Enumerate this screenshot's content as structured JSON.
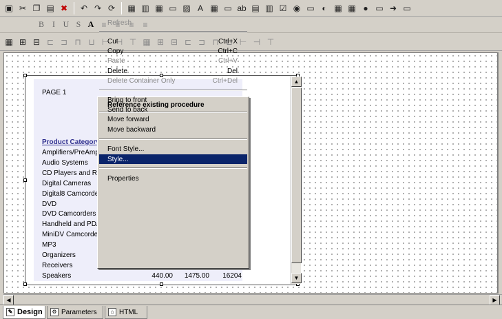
{
  "toolbar_icons": {
    "row1": [
      "save-icon",
      "cut-icon",
      "copy-icon",
      "paste-icon",
      "delete-icon",
      "undo-icon",
      "redo-icon",
      "refresh-icon",
      "form-icon",
      "chart-icon",
      "table-icon",
      "rectangle-icon",
      "image-icon",
      "text-icon",
      "grid-icon",
      "label-icon",
      "textbox-icon",
      "listbox-icon",
      "combo-icon",
      "checkbox-icon",
      "radio-icon",
      "button-icon",
      "palette-icon",
      "calendar-icon",
      "crosstab-icon",
      "color-icon",
      "window-icon",
      "arrow-icon",
      "border-icon"
    ],
    "format_glyphs": [
      "B",
      "I",
      "U",
      "S",
      "A"
    ],
    "row3_count": 20
  },
  "report": {
    "page_label": "PAGE  1",
    "column_header": "Product Category",
    "rows": [
      "Amplifiers/PreAmps",
      "Audio Systems",
      "CD Players and Recorders",
      "Digital Cameras",
      "Digital8 Camcorders",
      "DVD",
      "DVD Camcorders",
      "Handheld and PDA",
      "MiniDV Camcorders",
      "MP3",
      "Organizers",
      "Receivers",
      "Speakers"
    ],
    "speakers_values": [
      "440.00",
      "1475.00",
      "16204"
    ]
  },
  "context_menu": {
    "header": "Reference existing procedure",
    "items": [
      {
        "label": "Refresh",
        "shortcut": "",
        "enabled": false
      },
      {
        "label": "Cut",
        "shortcut": "Ctrl+X",
        "enabled": true
      },
      {
        "label": "Copy",
        "shortcut": "Ctrl+C",
        "enabled": true
      },
      {
        "label": "Paste",
        "shortcut": "Ctrl+V",
        "enabled": false
      },
      {
        "label": "Delete",
        "shortcut": "Del",
        "enabled": true
      },
      {
        "label": "Delete Container Only",
        "shortcut": "Ctrl+Del",
        "enabled": false
      },
      {
        "label": "Bring to front",
        "shortcut": "",
        "enabled": true
      },
      {
        "label": "Send to back",
        "shortcut": "",
        "enabled": true
      },
      {
        "label": "Move forward",
        "shortcut": "",
        "enabled": true
      },
      {
        "label": "Move backward",
        "shortcut": "",
        "enabled": true
      },
      {
        "label": "Font Style...",
        "shortcut": "",
        "enabled": true
      },
      {
        "label": "Style...",
        "shortcut": "",
        "enabled": true,
        "selected": true
      },
      {
        "label": "Properties",
        "shortcut": "",
        "enabled": true
      }
    ]
  },
  "tabs": [
    {
      "label": "Design",
      "active": true
    },
    {
      "label": "Parameters",
      "active": false
    },
    {
      "label": "HTML",
      "active": false
    }
  ],
  "colors": {
    "selection": "#0a246a",
    "chrome": "#d4d0c8",
    "header_link": "#2f2f8f"
  }
}
